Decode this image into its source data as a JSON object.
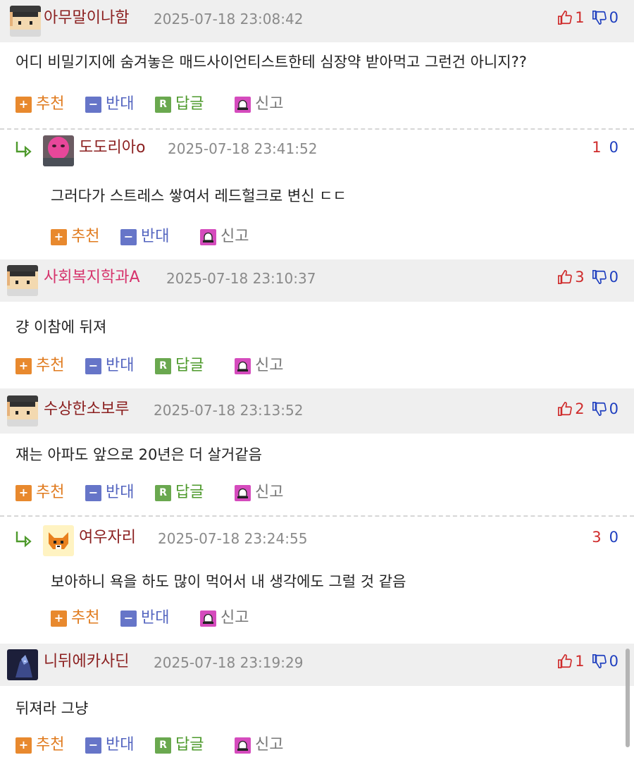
{
  "colors": {
    "nick_brown": "#8b1f1f",
    "nick_pink": "#d6336c",
    "header_bg": "#efefef",
    "up_red": "#cf2b2b",
    "down_blue": "#1f3fbf"
  },
  "actions": {
    "recommend": "추천",
    "oppose": "반대",
    "reply": "답글",
    "report": "신고"
  },
  "comments": [
    {
      "kind": "top",
      "avatar": "pixel-student-avatar",
      "nick": "아무말이나함",
      "date": "2025-07-18 23:08:42",
      "up": "1",
      "down": "0",
      "body": "어디 비밀기지에 숨겨놓은 매드사이언티스트한테 심장약 받아먹고 그런건 아니지??"
    },
    {
      "kind": "reply",
      "avatar": "pink-photo-avatar",
      "nick": "도도리아o",
      "date": "2025-07-18 23:41:52",
      "up": "1",
      "down": "0",
      "body": "그러다가 스트레스 쌓여서 레드헐크로 변신 ㄷㄷ"
    },
    {
      "kind": "top",
      "avatar": "pixel-student-avatar",
      "nick": "사회복지학과A",
      "date": "2025-07-18 23:10:37",
      "up": "3",
      "down": "0",
      "body": "걍 이참에 뒤져"
    },
    {
      "kind": "top",
      "avatar": "pixel-student-avatar",
      "nick": "수상한소보루",
      "date": "2025-07-18 23:13:52",
      "up": "2",
      "down": "0",
      "body": "쟤는 아파도 앞으로 20년은 더 살거같음"
    },
    {
      "kind": "reply",
      "avatar": "pixel-fox-avatar",
      "nick": "여우자리",
      "date": "2025-07-18 23:24:55",
      "up": "3",
      "down": "0",
      "body": "보아하니 욕을 하도 많이 먹어서 내 생각에도 그럴 것 같음"
    },
    {
      "kind": "top",
      "avatar": "dark-character-avatar",
      "nick": "니뒤에카사딘",
      "date": "2025-07-18 23:19:29",
      "up": "1",
      "down": "0",
      "body": "뒤져라 그냥"
    }
  ]
}
